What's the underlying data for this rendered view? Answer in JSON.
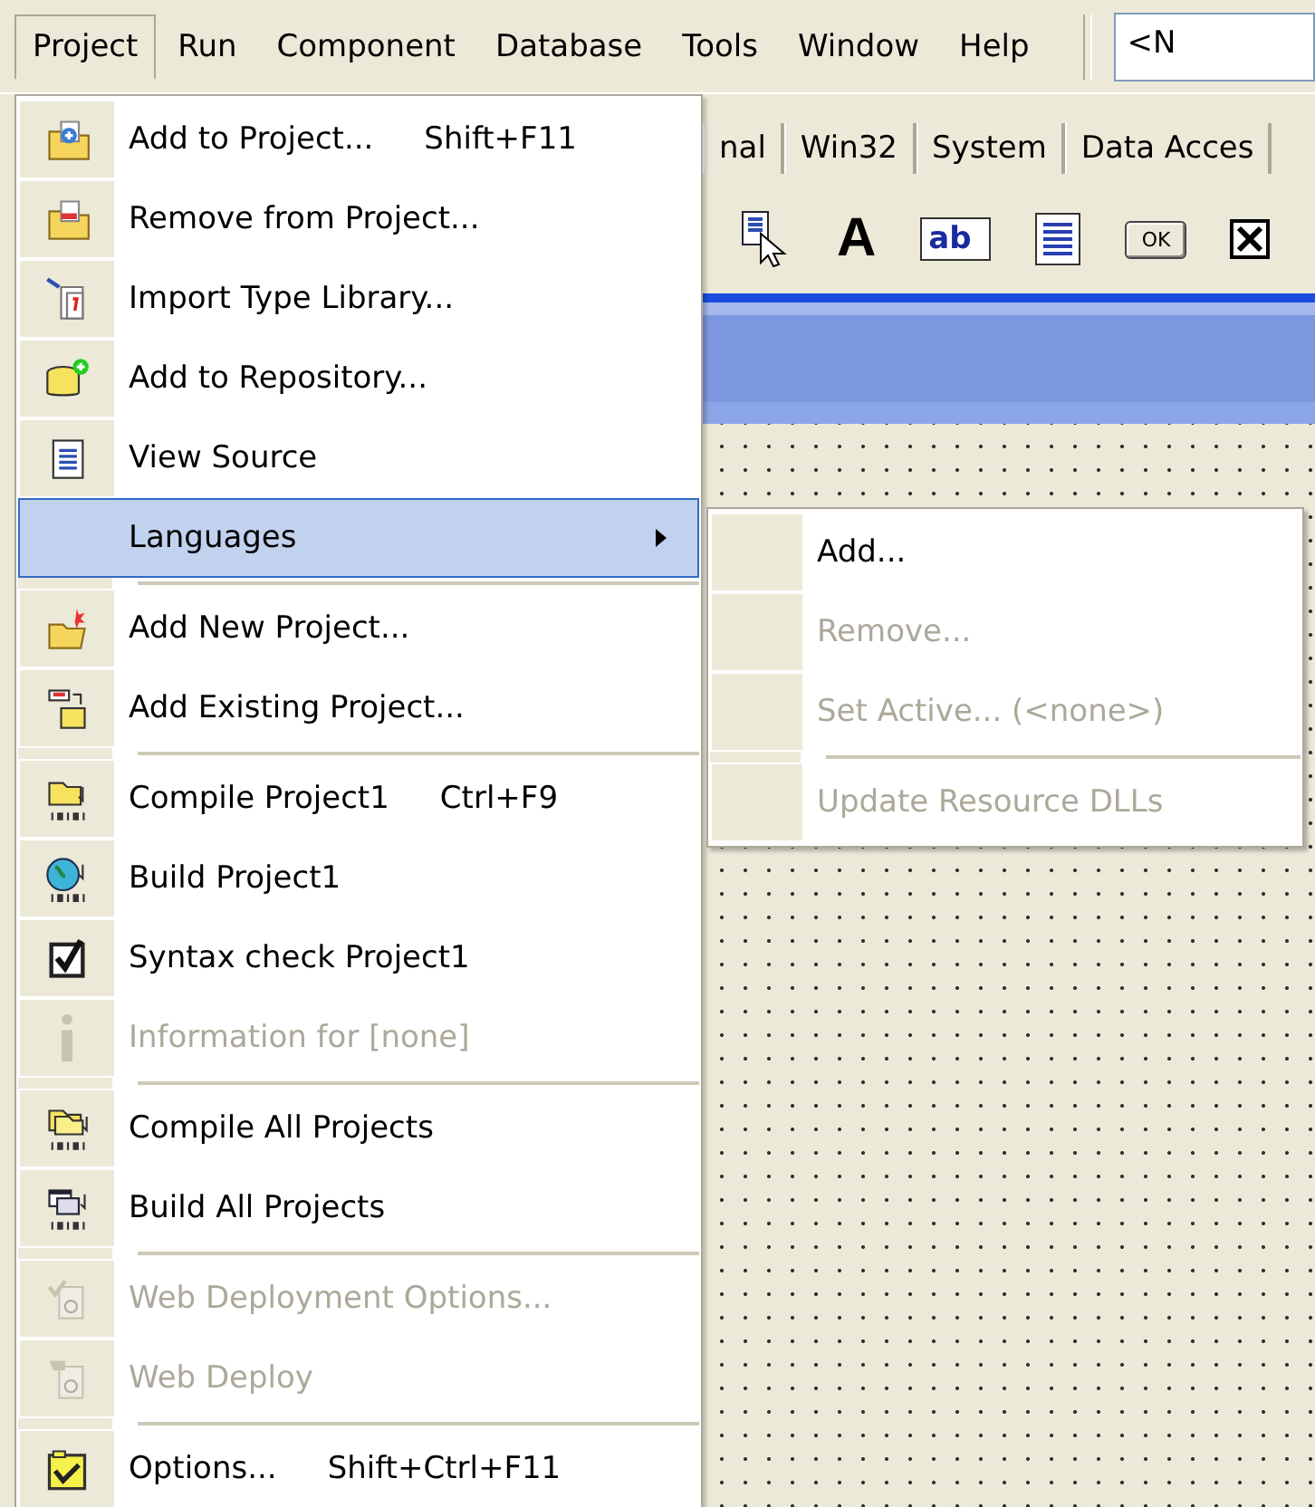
{
  "menubar": {
    "items": [
      {
        "label": "Project",
        "selected": true
      },
      {
        "label": "Run",
        "selected": false
      },
      {
        "label": "Component",
        "selected": false
      },
      {
        "label": "Database",
        "selected": false
      },
      {
        "label": "Tools",
        "selected": false
      },
      {
        "label": "Window",
        "selected": false
      },
      {
        "label": "Help",
        "selected": false
      }
    ],
    "combo": "<N"
  },
  "palette": {
    "tabs": [
      "nal",
      "Win32",
      "System",
      "Data Acces"
    ],
    "tools": [
      {
        "kind": "pointer"
      },
      {
        "kind": "label",
        "text": "A"
      },
      {
        "kind": "edit",
        "text": "ab"
      },
      {
        "kind": "memo"
      },
      {
        "kind": "button",
        "text": "OK"
      },
      {
        "kind": "checkbox",
        "checked": true
      }
    ]
  },
  "project_menu": [
    {
      "kind": "item",
      "label": "Add to Project...",
      "shortcut": "Shift+F11",
      "disabled": false,
      "selected": false
    },
    {
      "kind": "item",
      "label": "Remove from Project...",
      "disabled": false,
      "selected": false
    },
    {
      "kind": "item",
      "label": "Import Type Library...",
      "disabled": false,
      "selected": false
    },
    {
      "kind": "item",
      "label": "Add to Repository...",
      "disabled": false,
      "selected": false
    },
    {
      "kind": "item",
      "label": "View Source",
      "disabled": false,
      "selected": false
    },
    {
      "kind": "submenu",
      "label": "Languages",
      "disabled": false,
      "selected": true
    },
    {
      "kind": "separator"
    },
    {
      "kind": "item",
      "label": "Add New Project...",
      "disabled": false,
      "selected": false
    },
    {
      "kind": "item",
      "label": "Add Existing Project...",
      "disabled": false,
      "selected": false
    },
    {
      "kind": "separator"
    },
    {
      "kind": "item",
      "label": "Compile Project1",
      "shortcut": "Ctrl+F9",
      "disabled": false,
      "selected": false
    },
    {
      "kind": "item",
      "label": "Build Project1",
      "disabled": false,
      "selected": false
    },
    {
      "kind": "item",
      "label": "Syntax check Project1",
      "disabled": false,
      "selected": false
    },
    {
      "kind": "item",
      "label": "Information for [none]",
      "disabled": true,
      "selected": false
    },
    {
      "kind": "separator"
    },
    {
      "kind": "item",
      "label": "Compile All Projects",
      "disabled": false,
      "selected": false
    },
    {
      "kind": "item",
      "label": "Build All Projects",
      "disabled": false,
      "selected": false
    },
    {
      "kind": "separator"
    },
    {
      "kind": "item",
      "label": "Web Deployment Options...",
      "disabled": true,
      "selected": false
    },
    {
      "kind": "item",
      "label": "Web Deploy",
      "disabled": true,
      "selected": false
    },
    {
      "kind": "separator"
    },
    {
      "kind": "item",
      "label": "Options...",
      "shortcut": "Shift+Ctrl+F11",
      "disabled": false,
      "selected": false
    }
  ],
  "languages_submenu": [
    {
      "kind": "item",
      "label": "Add...",
      "disabled": false
    },
    {
      "kind": "item",
      "label": "Remove...",
      "disabled": true
    },
    {
      "kind": "item",
      "label": "Set Active...  (<none>)",
      "disabled": true
    },
    {
      "kind": "separator"
    },
    {
      "kind": "item",
      "label": "Update Resource DLLs",
      "disabled": true
    }
  ]
}
